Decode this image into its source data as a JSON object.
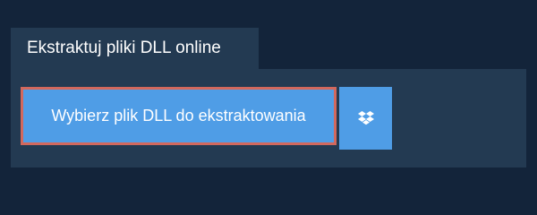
{
  "tab": {
    "label": "Ekstraktuj pliki DLL online"
  },
  "actions": {
    "select_file_label": "Wybierz plik DLL do ekstraktowania",
    "dropbox_icon": "dropbox-icon"
  },
  "colors": {
    "page_background": "#13243a",
    "panel_background": "#233a52",
    "button_background": "#4f9de6",
    "button_focus_border": "#d2685d",
    "text": "#ffffff"
  }
}
